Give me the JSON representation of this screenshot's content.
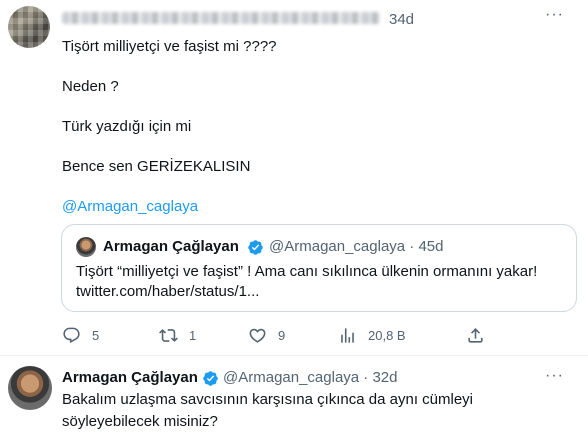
{
  "tweet": {
    "time": "34d",
    "lines": [
      "Tişört milliyetçi ve faşist mi ????",
      "Neden ?",
      "Türk yazdığı için mi",
      "Bence sen GERİZEKALISIN",
      "@Armagan_caglaya"
    ],
    "quote": {
      "name": "Armagan Çağlayan",
      "handle_time": "@Armagan_caglaya · 45d",
      "text_line1": "Tişört  “milliyetçi ve faşist” !  Ama canı sıkılınca ülkenin ormanını yakar!",
      "text_line2": "twitter.com/haber/status/1..."
    },
    "actions": {
      "replies": "5",
      "retweets": "1",
      "likes": "9",
      "views": "20,8 B"
    }
  },
  "reply": {
    "name": "Armagan Çağlayan",
    "handle_time": "@Armagan_caglaya · 32d",
    "line1": "Bakalım uzlaşma savcısının karşısına çıkınca da aynı cümleyi",
    "line2": "söyleyebilecek misiniz?"
  },
  "colors": {
    "text": "#0f1419",
    "secondary": "#536471",
    "link": "#1d9bf0",
    "verified": "#1d9bf0",
    "border": "#cfd9de"
  },
  "icons": [
    "more-icon",
    "verified-icon",
    "reply-icon",
    "retweet-icon",
    "like-icon",
    "views-icon",
    "share-icon"
  ]
}
